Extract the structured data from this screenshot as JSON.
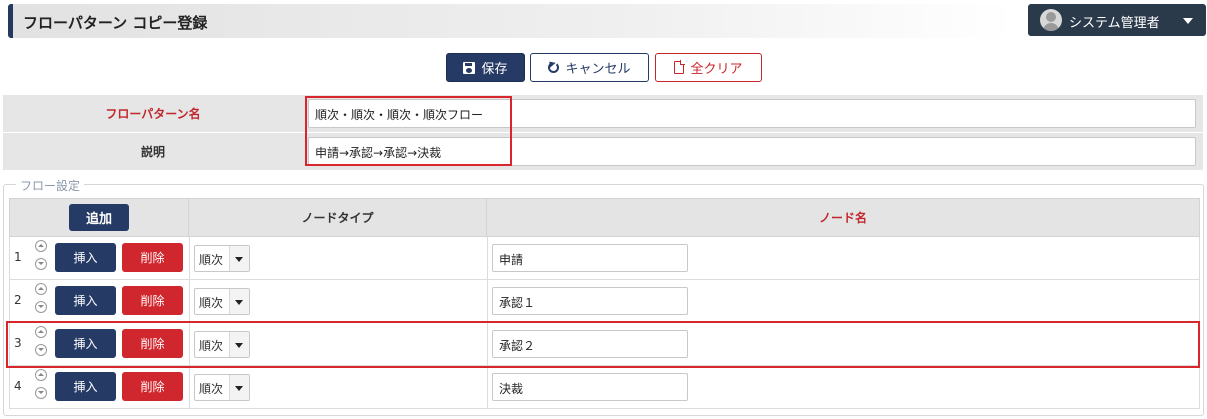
{
  "header": {
    "title": "フローパターン コピー登録",
    "user_menu_label": "システム管理者"
  },
  "toolbar": {
    "save_label": "保存",
    "cancel_label": "キャンセル",
    "clear_label": "全クリア"
  },
  "form": {
    "pattern_name_label": "フローパターン名",
    "pattern_name_value": "順次・順次・順次・順次フロー",
    "description_label": "説明",
    "description_value": "申請→承認→承認→決裁"
  },
  "flow": {
    "legend": "フロー設定",
    "add_label": "追加",
    "col_node_type": "ノードタイプ",
    "col_node_name": "ノード名",
    "insert_label": "挿入",
    "delete_label": "削除",
    "rows": [
      {
        "no": "1",
        "type": "順次",
        "name": "申請"
      },
      {
        "no": "2",
        "type": "順次",
        "name": "承認１"
      },
      {
        "no": "3",
        "type": "順次",
        "name": "承認２"
      },
      {
        "no": "4",
        "type": "順次",
        "name": "決裁"
      }
    ]
  },
  "colors": {
    "primary": "#263a66",
    "danger": "#d0262d",
    "required_label": "#c1272d",
    "highlight": "#d9262c"
  }
}
